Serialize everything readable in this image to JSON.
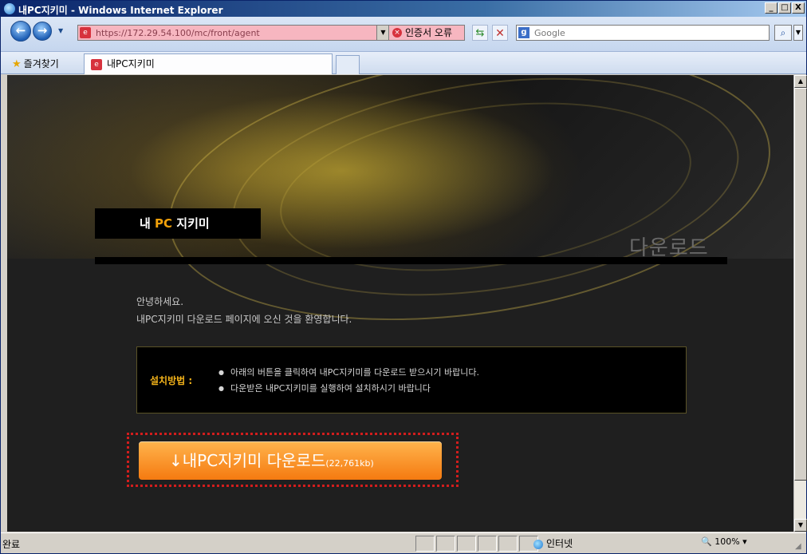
{
  "window": {
    "title": "내PC지키미 - Windows Internet Explorer",
    "controls": {
      "minimize": "_",
      "maximize": "□",
      "close": "X"
    }
  },
  "toolbar": {
    "address": "https://172.29.54.100/mc/front/agent",
    "cert_error": "인증서 오류",
    "search_placeholder": "Google"
  },
  "favorites": {
    "label": "즐겨찾기",
    "tab_title": "내PC지키미"
  },
  "page": {
    "brand_prefix": "내",
    "brand_pc": "PC",
    "brand_suffix": "지키미",
    "section_title": "다운로드",
    "greeting_line1": "안녕하세요.",
    "greeting_line2": "내PC지키미 다운로드 페이지에 오신 것을 환영합니다.",
    "install_label": "설치방법 :",
    "install_steps": [
      "아래의 버튼을 클릭하여 내PC지키미를 다운로드 받으시기 바랍니다.",
      "다운받은 내PC지키미를 실행하여 설치하시기 바랍니다"
    ],
    "download_button": "↓내PC지키미 다운로드",
    "download_size": "(22,761kb)"
  },
  "statusbar": {
    "status": "완료",
    "zone": "인터넷",
    "zoom": "100%"
  },
  "colors": {
    "accent_orange": "#f57a10",
    "brand_pc": "#f2a10a",
    "cert_error_bg": "#f7b6c0",
    "dotted_outline": "#d21d1d"
  }
}
